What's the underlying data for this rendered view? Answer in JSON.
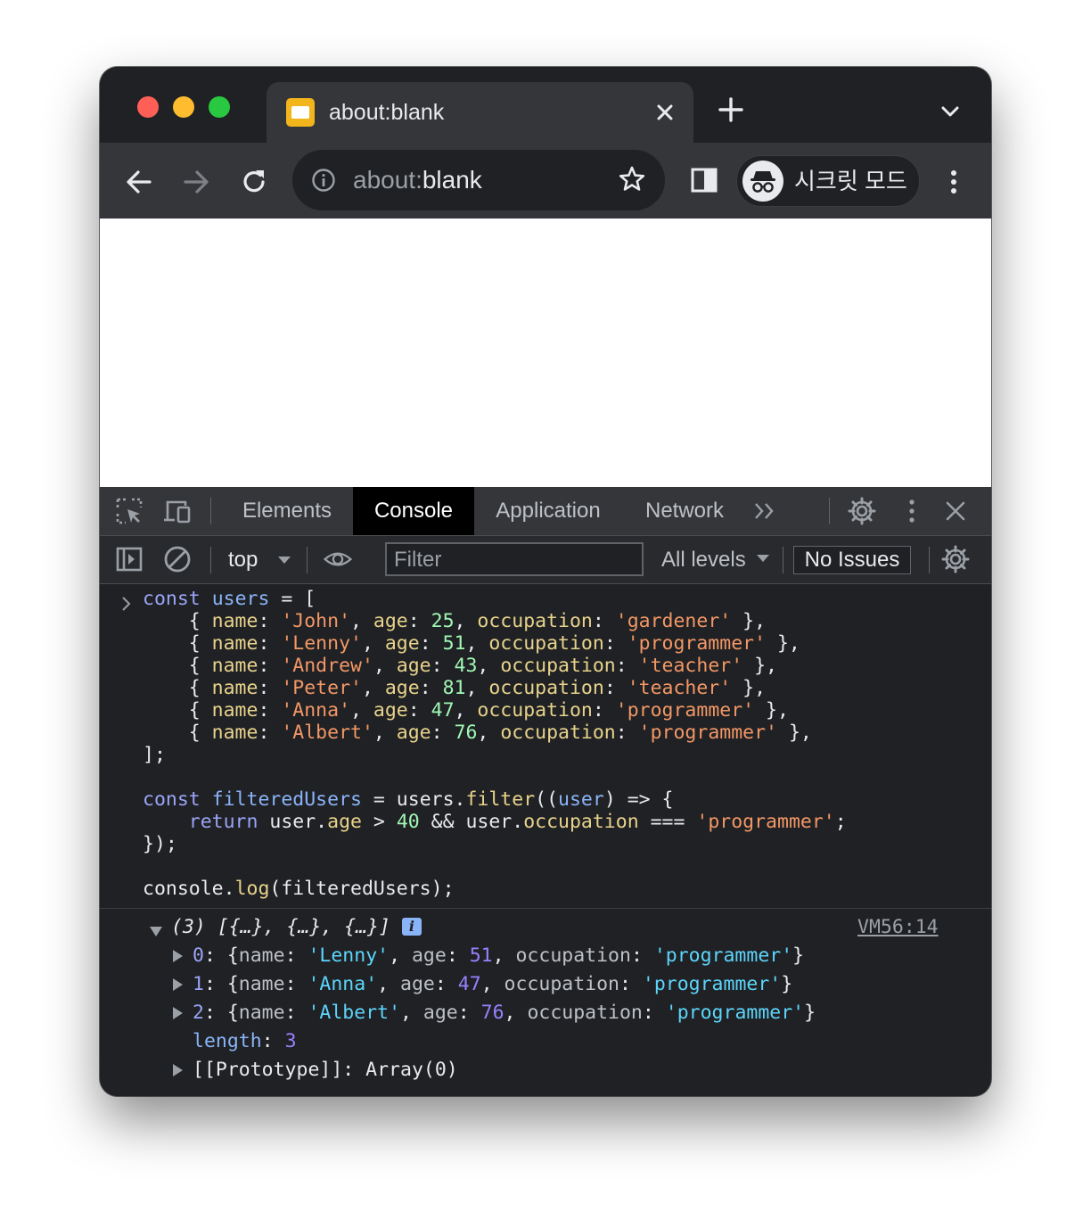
{
  "browser": {
    "tab": {
      "title": "about:blank",
      "close_icon": "close-icon"
    },
    "toolbar": {
      "url_scheme": "about:",
      "url_host": "blank",
      "incognito_label": "시크릿 모드"
    }
  },
  "devtools": {
    "tabs": [
      {
        "label": "Elements",
        "active": false
      },
      {
        "label": "Console",
        "active": true
      },
      {
        "label": "Application",
        "active": false
      },
      {
        "label": "Network",
        "active": false
      }
    ],
    "console_bar": {
      "context": "top",
      "filter_placeholder": "Filter",
      "levels": "All levels",
      "issues": "No Issues"
    },
    "input_code": {
      "l1": [
        "const",
        "users",
        "= ["
      ],
      "rows": [
        {
          "name": "'John'",
          "age": "25",
          "occupation": "'gardener'",
          "tail": " },"
        },
        {
          "name": "'Lenny'",
          "age": "51",
          "occupation": "'programmer'",
          "tail": " },"
        },
        {
          "name": "'Andrew'",
          "age": "43",
          "occupation": "'teacher'",
          "tail": " },"
        },
        {
          "name": "'Peter'",
          "age": "81",
          "occupation": "'teacher'",
          "tail": " },"
        },
        {
          "name": "'Anna'",
          "age": "47",
          "occupation": "'programmer'",
          "tail": " },"
        },
        {
          "name": "'Albert'",
          "age": "76",
          "occupation": "'programmer'",
          "tail": " },"
        }
      ],
      "close": "];",
      "filter_line": [
        "const",
        "filteredUsers",
        " = users.",
        "filter",
        "((",
        "user",
        ") => {"
      ],
      "return_line": [
        "return",
        " user.",
        "age",
        " > ",
        "40",
        " && user.",
        "occupation",
        " === ",
        "'programmer'",
        ";"
      ],
      "close_fn": "});",
      "log_line": [
        "console.",
        "log",
        "(filteredUsers);"
      ]
    },
    "output": {
      "summary": "(3) [{…}, {…}, {…}]",
      "source": "VM56:14",
      "items": [
        {
          "index": "0",
          "name": "'Lenny'",
          "age": "51",
          "occupation": "'programmer'"
        },
        {
          "index": "1",
          "name": "'Anna'",
          "age": "47",
          "occupation": "'programmer'"
        },
        {
          "index": "2",
          "name": "'Albert'",
          "age": "76",
          "occupation": "'programmer'"
        }
      ],
      "length_key": "length",
      "length_value": "3",
      "prototype": "[[Prototype]]: Array(0)"
    }
  }
}
